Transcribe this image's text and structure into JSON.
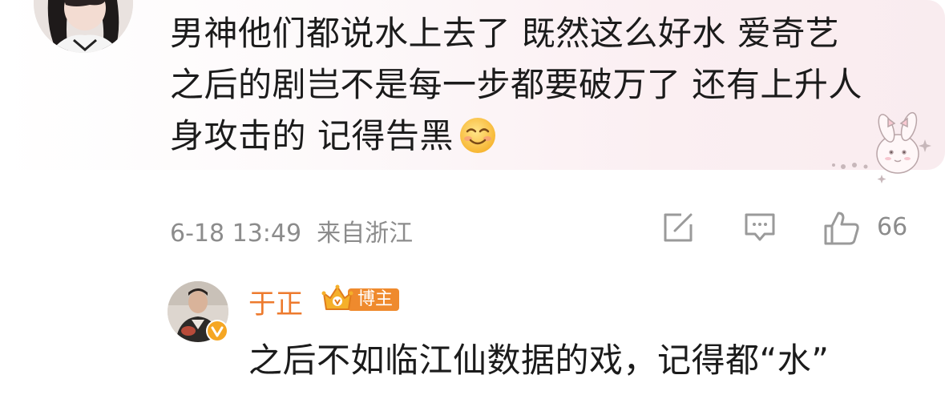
{
  "comment": {
    "lines": [
      "男神他们都说水上去了 既然这么好水 爱奇艺",
      "之后的剧岂不是每一步都要破万了 还有上升人",
      "身攻击的 记得告黑"
    ],
    "emoji": "smile-emoji",
    "meta": {
      "time": "6-18 13:49",
      "location": "来自浙江"
    },
    "like_count": "66",
    "card_colors": {
      "gradient_start": "#ffffff",
      "gradient_end": "#f9ecef"
    }
  },
  "reply": {
    "author": "于正",
    "badge_label": "博主",
    "text": "之后不如临江仙数据的戏，记得都“水”",
    "name_color": "#ed7a2d",
    "badge_color": "#ef8a2d",
    "verified_color": "#f5a623"
  },
  "icons": {
    "share": "share-icon",
    "comment": "comment-icon",
    "like": "thumbs-up-icon"
  }
}
